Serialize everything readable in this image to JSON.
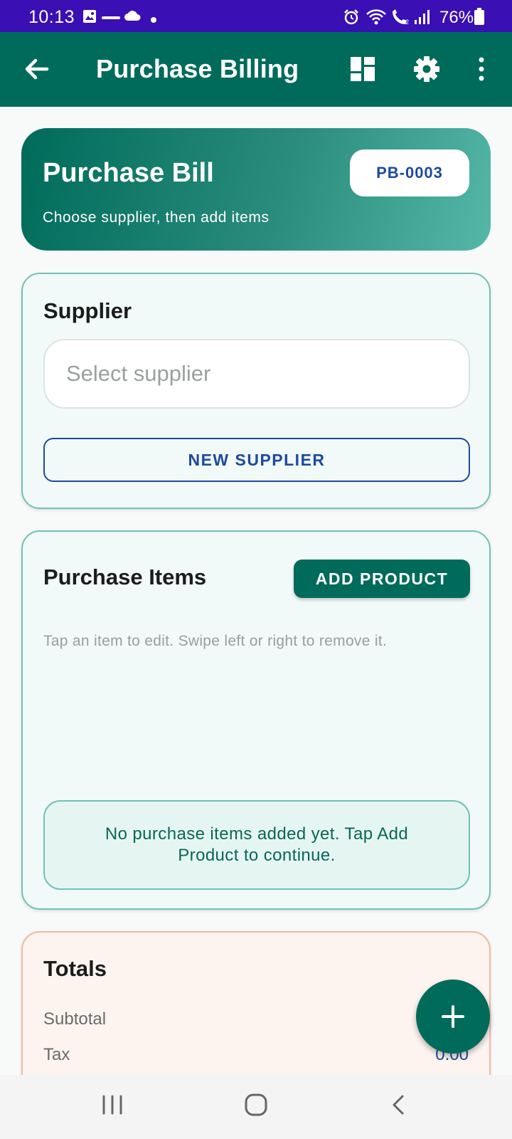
{
  "status_bar": {
    "time": "10:13",
    "battery": "76%",
    "notification_icons": [
      "image-icon",
      "zomato-icon",
      "cloud-icon",
      "dot-icon"
    ],
    "system_icons": [
      "alarm-icon",
      "wifi-icon",
      "wifi-call-icon",
      "signal-icon",
      "battery-icon"
    ]
  },
  "app_bar": {
    "title": "Purchase Billing",
    "actions": [
      "back-arrow-icon",
      "dashboard-icon",
      "gear-icon",
      "more-vert-icon"
    ]
  },
  "hero": {
    "title": "Purchase Bill",
    "subtitle": "Choose supplier, then add items",
    "bill_number": "PB-0003"
  },
  "supplier": {
    "heading": "Supplier",
    "placeholder": "Select supplier",
    "new_button": "NEW SUPPLIER"
  },
  "items": {
    "heading": "Purchase Items",
    "add_button": "ADD PRODUCT",
    "hint": "Tap an item to edit. Swipe left or right to remove it.",
    "empty_message": "No purchase items added yet. Tap Add Product to continue."
  },
  "totals": {
    "heading": "Totals",
    "rows": [
      {
        "label": "Subtotal",
        "value": ""
      },
      {
        "label": "Tax",
        "value": "0.00"
      }
    ]
  },
  "fab": {
    "icon": "plus-icon"
  },
  "nav_bar": {
    "buttons": [
      "recents-icon",
      "home-icon",
      "back-icon"
    ]
  },
  "colors": {
    "status_bar": "#3a0fb4",
    "primary": "#006b5a",
    "accent_blue": "#1d4aa0",
    "card_border": "#72c1b6",
    "totals_border": "#f0b8a3"
  }
}
